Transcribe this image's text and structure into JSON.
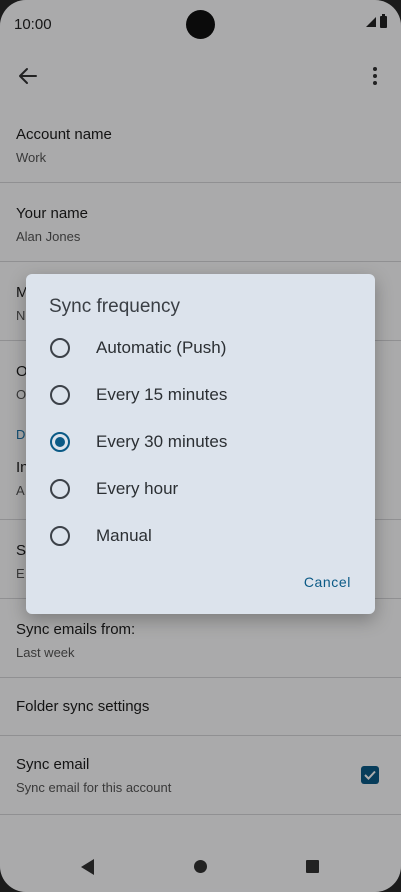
{
  "status_bar": {
    "time": "10:00"
  },
  "settings": {
    "account_name": {
      "title": "Account name",
      "value": "Work"
    },
    "your_name": {
      "title": "Your name",
      "value": "Alan Jones"
    },
    "partial_row_1": {
      "title": "M",
      "value": "N"
    },
    "partial_row_2": {
      "title": "O",
      "value": "O"
    },
    "partial_section": {
      "title": "D"
    },
    "partial_row_3": {
      "title": "In",
      "value": "A"
    },
    "partial_row_4": {
      "title": "S",
      "value": "E"
    },
    "sync_emails_from": {
      "title": "Sync emails from:",
      "value": "Last week"
    },
    "folder_sync": {
      "title": "Folder sync settings"
    },
    "sync_email": {
      "title": "Sync email",
      "value": "Sync email for this account",
      "checked": true
    }
  },
  "dialog": {
    "title": "Sync frequency",
    "options": [
      {
        "label": "Automatic (Push)",
        "selected": false
      },
      {
        "label": "Every 15 minutes",
        "selected": false
      },
      {
        "label": "Every 30 minutes",
        "selected": true
      },
      {
        "label": "Every hour",
        "selected": false
      },
      {
        "label": "Manual",
        "selected": false
      }
    ],
    "cancel_label": "Cancel"
  },
  "colors": {
    "accent": "#0b5a86",
    "dialog_bg": "#dce3ec",
    "section_header": "#1a73a8"
  }
}
